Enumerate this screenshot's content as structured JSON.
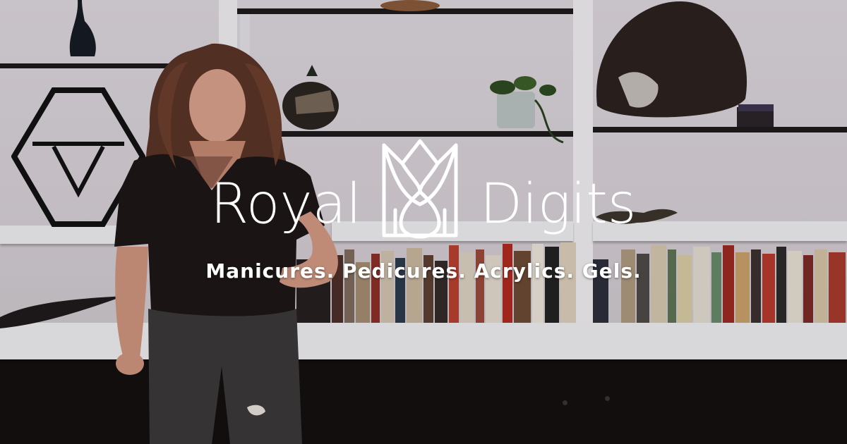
{
  "brand": {
    "name_left": "Royal",
    "name_right": "Digits",
    "tagline": "Manicures. Pedicures. Acrylics. Gels."
  },
  "colors": {
    "logo": "#ffffff",
    "wall": "#d9d4da",
    "shelf": "#efeff2",
    "cabinet": "#141010"
  },
  "icons": [
    "tulip-crown-logo-icon"
  ]
}
